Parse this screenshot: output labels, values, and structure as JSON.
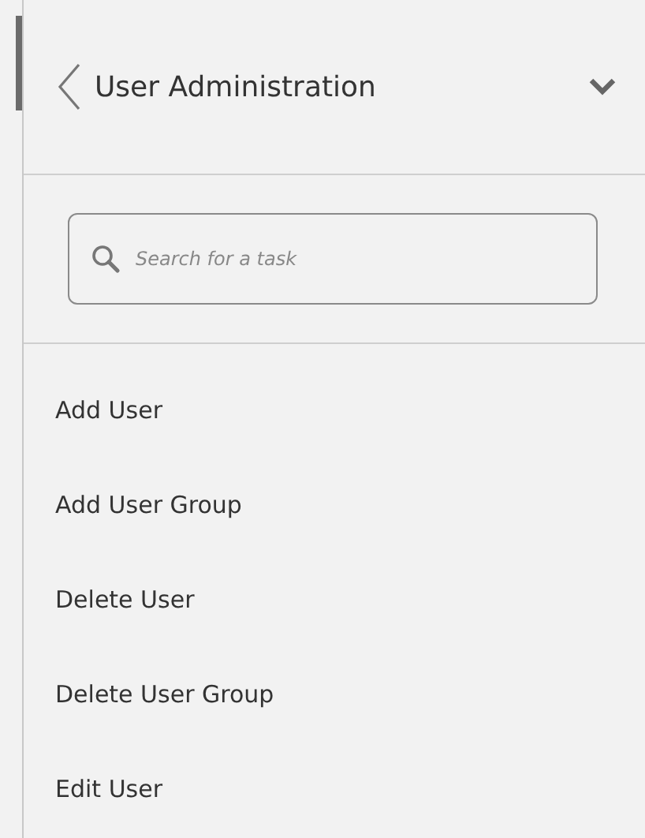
{
  "header": {
    "title": "User Administration"
  },
  "search": {
    "placeholder": "Search for a task"
  },
  "tasks": [
    {
      "label": "Add User"
    },
    {
      "label": "Add User Group"
    },
    {
      "label": "Delete User"
    },
    {
      "label": "Delete User Group"
    },
    {
      "label": "Edit User"
    }
  ]
}
